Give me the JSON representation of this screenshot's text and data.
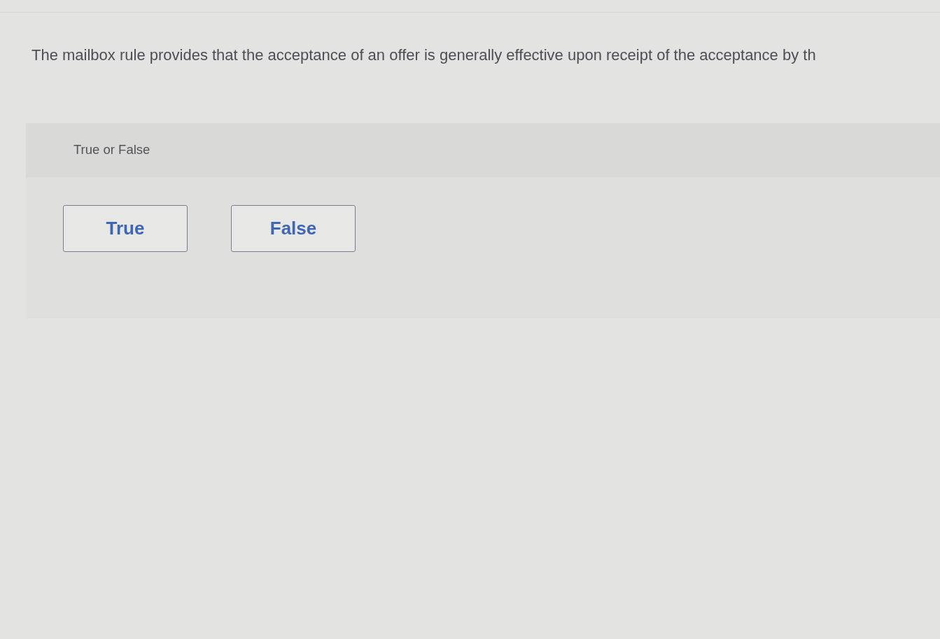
{
  "question": {
    "text": "The mailbox rule provides that the acceptance of an offer is generally effective upon receipt of the acceptance by th"
  },
  "answer_panel": {
    "prompt": "True or False",
    "options": [
      {
        "label": "True",
        "selected": false
      },
      {
        "label": "False",
        "selected": false
      }
    ]
  }
}
